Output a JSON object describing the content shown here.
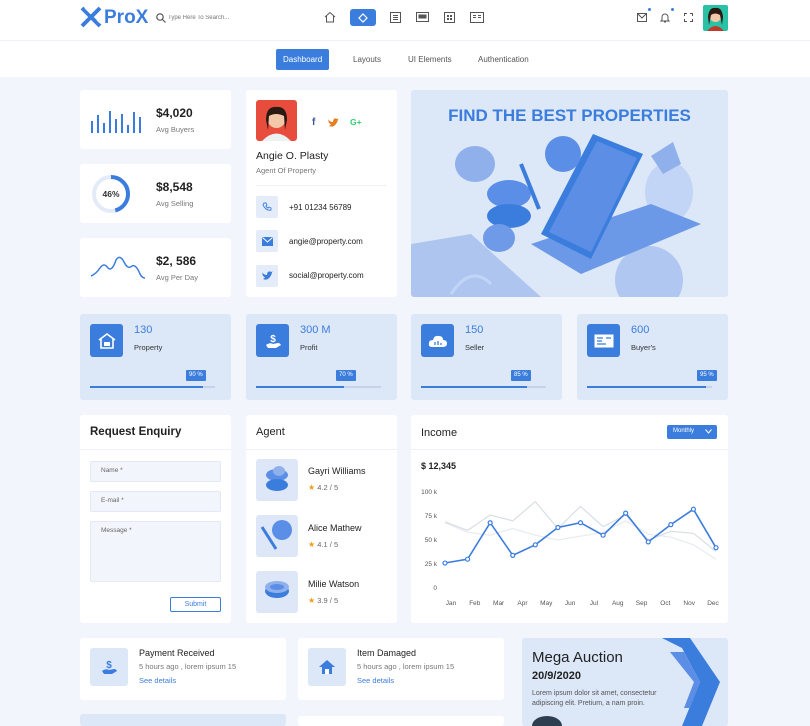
{
  "brand": {
    "name": "ProX",
    "accent": "#3b7ddd"
  },
  "search": {
    "placeholder": "Type Here To Search..."
  },
  "top_icons": [
    "home-icon",
    "diamond-icon",
    "list-icon",
    "monitor-icon",
    "grid-icon",
    "card-icon"
  ],
  "right_icons": [
    "mail-icon",
    "bell-icon",
    "fullscreen-icon",
    "avatar"
  ],
  "nav_tabs": [
    {
      "label": "Dashboard",
      "active": true
    },
    {
      "label": "Layouts"
    },
    {
      "label": "UI Elements"
    },
    {
      "label": "Authentication"
    }
  ],
  "stats": [
    {
      "value": "$4,020",
      "label": "Avg Buyers",
      "icon": "bar-chart-icon"
    },
    {
      "value": "$8,548",
      "label": "Avg Selling",
      "percent": "46%"
    },
    {
      "value": "$2, 586",
      "label": "Avg Per Day",
      "icon": "wave-chart-icon"
    }
  ],
  "profile": {
    "name": "Angie O. Plasty",
    "role": "Agent Of Property",
    "phone": "+91 01234 56789",
    "email": "angie@property.com",
    "social": "social@property.com",
    "socials": [
      "facebook-icon",
      "twitter-icon",
      "google-plus-icon"
    ]
  },
  "banner": {
    "title": "FIND THE BEST PROPERTIES"
  },
  "kpis": [
    {
      "value": "130",
      "label": "Property",
      "percent": "90 %",
      "fill": 0.9
    },
    {
      "value": "300 M",
      "label": "Profit",
      "percent": "70 %",
      "fill": 0.7
    },
    {
      "value": "150",
      "label": "Seller",
      "percent": "85 %",
      "fill": 0.85
    },
    {
      "value": "600",
      "label": "Buyer's",
      "percent": "95 %",
      "fill": 0.95
    }
  ],
  "enquiry": {
    "title": "Request Enquiry",
    "name_placeholder": "Name *",
    "email_placeholder": "E-mail *",
    "message_placeholder": "Message *",
    "submit": "Submit"
  },
  "agents": {
    "title": "Agent",
    "list": [
      {
        "name": "Gayri Williams",
        "rating": "4.2 / 5"
      },
      {
        "name": "Alice Mathew",
        "rating": "4.1 / 5"
      },
      {
        "name": "Milie Watson",
        "rating": "3.9 / 5"
      }
    ]
  },
  "income": {
    "title": "Income",
    "select": "Monthly",
    "total": "$ 12,345"
  },
  "chart_data": {
    "type": "line",
    "categories": [
      "Jan",
      "Feb",
      "Mar",
      "Apr",
      "May",
      "Jun",
      "Jul",
      "Aug",
      "Sep",
      "Oct",
      "Nov",
      "Dec"
    ],
    "yticks": [
      "0",
      "25 k",
      "50 k",
      "75 k",
      "100 k"
    ],
    "ylim": [
      0,
      100
    ],
    "series": [
      {
        "color": "#3b7ddd",
        "values": [
          26,
          30,
          68,
          34,
          45,
          63,
          68,
          55,
          78,
          48,
          66,
          82,
          42
        ]
      },
      {
        "color": "#d8dee8",
        "values": [
          69,
          60,
          76,
          70,
          90,
          62,
          85,
          64,
          76,
          50,
          59,
          57,
          38
        ]
      },
      {
        "color": "#e6eaf1",
        "values": [
          68,
          58,
          55,
          62,
          55,
          50,
          54,
          58,
          70,
          56,
          53,
          45,
          30
        ]
      }
    ]
  },
  "notifications": [
    {
      "title": "Payment Received",
      "sub": "5 hours ago , lorem ipsum 15",
      "link": "See details",
      "icon": "money-hand-icon"
    },
    {
      "title": "Item Damaged",
      "sub": "5 hours ago , lorem ipsum 15",
      "link": "See details",
      "icon": "house-icon"
    }
  ],
  "auction": {
    "title": "Mega Auction",
    "date": "20/9/2020",
    "text": "Lorem ipsum dolor sit amet, consectetur adipiscing elit. Pretium, a nam proin."
  }
}
